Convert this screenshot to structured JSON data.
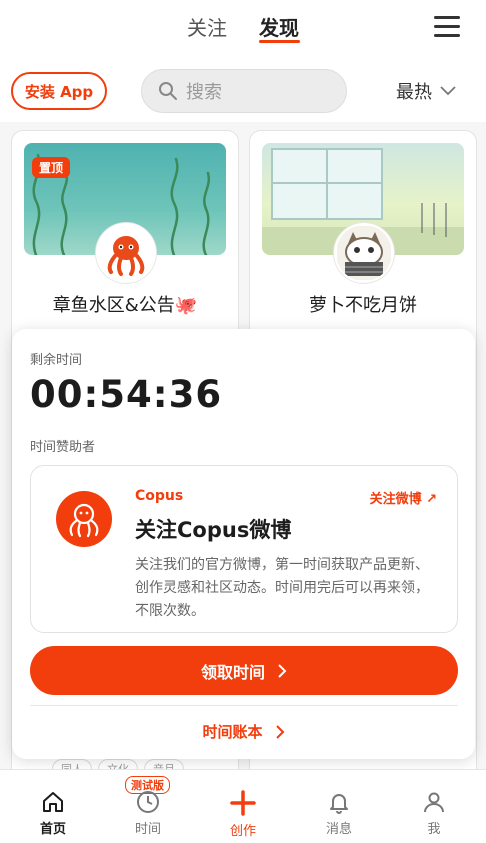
{
  "top_nav": {
    "tabs": [
      "关注",
      "发现"
    ],
    "active_tab": "发现",
    "menu_icon": "hamburger-menu-icon"
  },
  "action_bar": {
    "install_label": "安装 App",
    "search_placeholder": "搜索",
    "sort_label": "最热"
  },
  "cards": [
    {
      "title": "章鱼水区&公告",
      "badge": "置顶",
      "tags": [
        "同人",
        "文化",
        "音月"
      ]
    },
    {
      "title": "萝卜不吃月饼"
    }
  ],
  "timer_panel": {
    "remaining_label": "剩余时间",
    "timer": "00:54:36",
    "sponsor_label": "时间赞助者",
    "sponsor": {
      "brand": "Copus",
      "follow_label": "关注微博 ↗",
      "title": "关注Copus微博",
      "description": "关注我们的官方微博，第一时间获取产品更新、创作灵感和社区动态。时间用完后可以再来领，不限次数。"
    },
    "claim_label": "领取时间",
    "ledger_label": "时间账本"
  },
  "bottom_nav": {
    "items": [
      "首页",
      "时间",
      "创作",
      "消息",
      "我"
    ],
    "active": "首页",
    "beta_badge": "测试版"
  },
  "colors": {
    "accent": "#f23d0c",
    "text": "#1e1e1e",
    "muted": "#666666"
  }
}
